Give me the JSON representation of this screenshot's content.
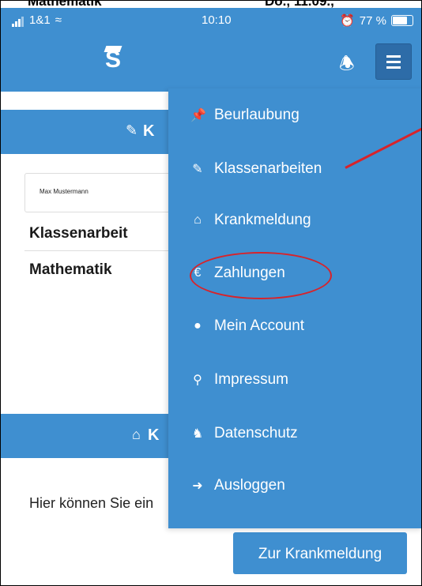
{
  "cut_row": {
    "left": "Mathematik",
    "right": "Do., 11.09.,"
  },
  "status_bar": {
    "carrier": "1&1",
    "time": "10:10",
    "battery": "77 %"
  },
  "header": {
    "logo_label": "S"
  },
  "page": {
    "section1_title": "K",
    "student_name": "Max Mustermann",
    "label_type": "Klassenarbeit",
    "label_subject": "Mathematik",
    "section2_title": "K",
    "info_text": "Hier können Sie ein",
    "button_label": "Zur Krankmeldung"
  },
  "menu": {
    "items": [
      {
        "label": "Beurlaubung",
        "icon": "pin-icon"
      },
      {
        "label": "Klassenarbeiten",
        "icon": "edit-icon"
      },
      {
        "label": "Krankmeldung",
        "icon": "home-icon"
      },
      {
        "label": "Zahlungen",
        "icon": "euro-icon"
      },
      {
        "label": "Mein Account",
        "icon": "user-icon"
      },
      {
        "label": "Impressum",
        "icon": "map-marker-icon"
      },
      {
        "label": "Datenschutz",
        "icon": "user-secret-icon"
      },
      {
        "label": "Ausloggen",
        "icon": "sign-out-icon"
      }
    ]
  },
  "colors": {
    "primary": "#3f8fd0",
    "button_dark": "#2d6ca8",
    "annotation_red": "#d8232a"
  }
}
